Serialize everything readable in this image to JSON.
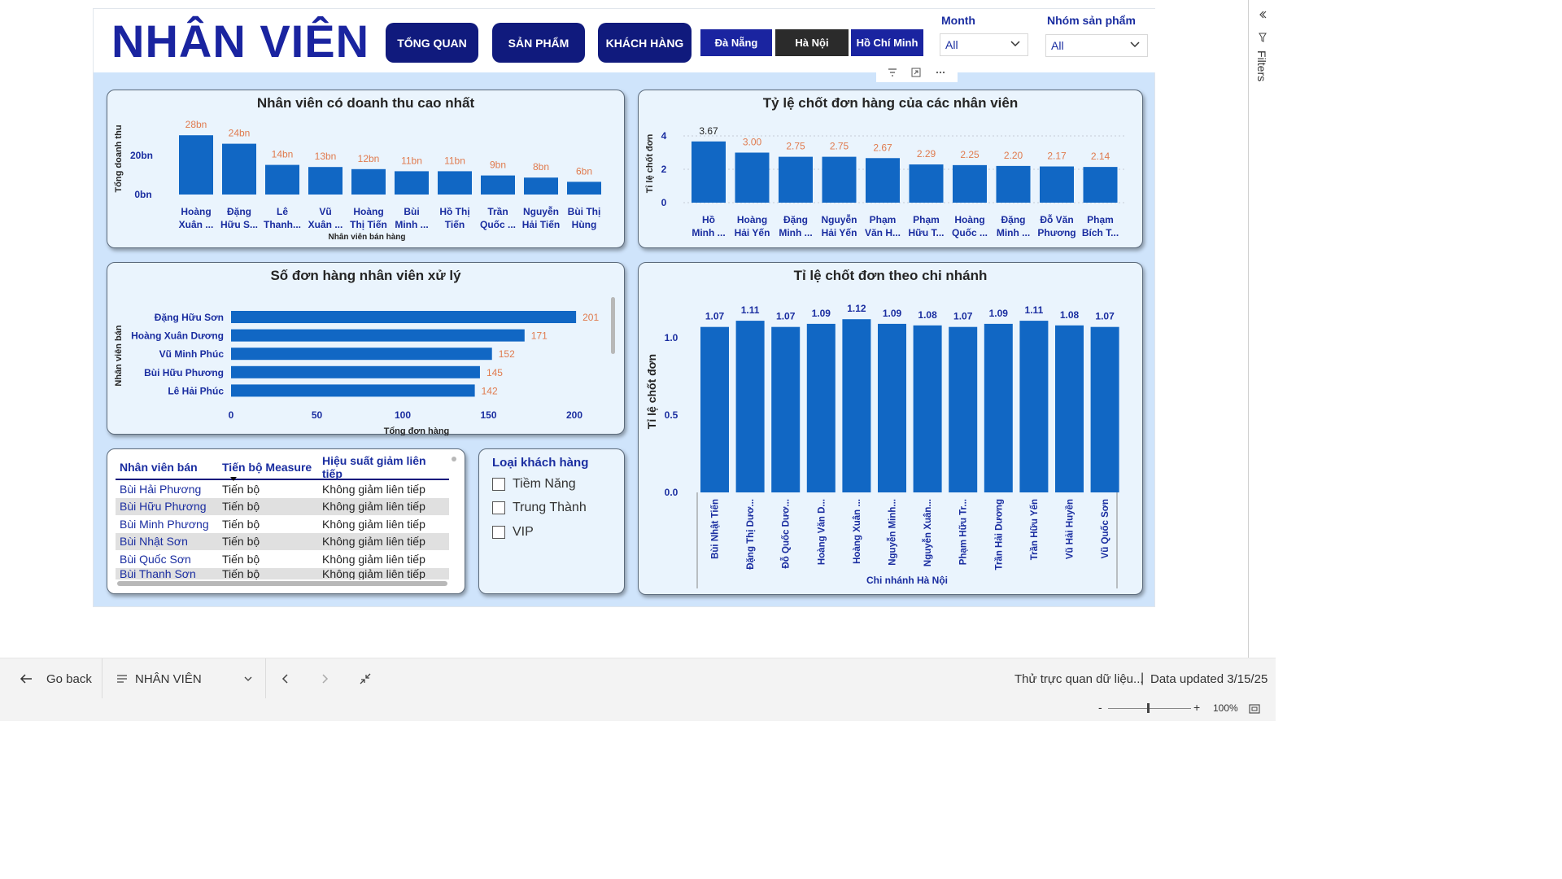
{
  "header": {
    "title": "NHÂN VIÊN",
    "nav_buttons": [
      "TỔNG QUAN",
      "SẢN PHẨM",
      "KHÁCH HÀNG"
    ],
    "city_buttons": [
      {
        "label": "Đà Nẵng",
        "color": "#1a24a0"
      },
      {
        "label": "Hà Nội",
        "color": "#2b2b2b"
      },
      {
        "label": "Hồ Chí Minh",
        "color": "#1a24a0"
      }
    ],
    "month_label": "Month",
    "month_value": "All",
    "group_label": "Nhóm sản phẩm",
    "group_value": "All"
  },
  "colors": {
    "bar": "#1167c4",
    "accent_dark": "#101a7d",
    "data_label": "#e07b4f",
    "panel_bg": "#eaf4fd"
  },
  "chart_data": [
    {
      "type": "bar",
      "title": "Nhân viên có doanh thu cao nhất",
      "xlabel": "Nhân viên bán hàng",
      "ylabel": "Tổng doanh thu",
      "y_ticks": [
        "0bn",
        "20bn"
      ],
      "categories": [
        [
          "Hoàng",
          "Xuân ..."
        ],
        [
          "Đặng",
          "Hữu S..."
        ],
        [
          "Lê",
          "Thanh..."
        ],
        [
          "Vũ",
          "Xuân ..."
        ],
        [
          "Hoàng",
          "Thị Tiến"
        ],
        [
          "Bùi",
          "Minh ..."
        ],
        [
          "Hồ Thị",
          "Tiến"
        ],
        [
          "Trần",
          "Quốc ..."
        ],
        [
          "Nguyễn",
          "Hải Tiến"
        ],
        [
          "Bùi Thị",
          "Hùng"
        ]
      ],
      "values": [
        28,
        24,
        14,
        13,
        12,
        11,
        11,
        9,
        8,
        6
      ],
      "labels": [
        "28bn",
        "24bn",
        "14bn",
        "13bn",
        "12bn",
        "11bn",
        "11bn",
        "9bn",
        "8bn",
        "6bn"
      ],
      "ylim": [
        0,
        30
      ]
    },
    {
      "type": "bar",
      "title": "Tỷ lệ chốt đơn hàng của các nhân viên",
      "ylabel": "Tỉ lệ chốt đơn",
      "y_ticks": [
        "0",
        "2",
        "4"
      ],
      "categories": [
        [
          "Hồ",
          "Minh ..."
        ],
        [
          "Hoàng",
          "Hải Yến"
        ],
        [
          "Đặng",
          "Minh ..."
        ],
        [
          "Nguyễn",
          "Hải Yến"
        ],
        [
          "Phạm",
          "Văn H..."
        ],
        [
          "Phạm",
          "Hữu T..."
        ],
        [
          "Hoàng",
          "Quốc ..."
        ],
        [
          "Đặng",
          "Minh ..."
        ],
        [
          "Đỗ Văn",
          "Phương"
        ],
        [
          "Phạm",
          "Bích T..."
        ]
      ],
      "values": [
        3.67,
        3.0,
        2.75,
        2.75,
        2.67,
        2.29,
        2.25,
        2.2,
        2.17,
        2.14
      ],
      "labels": [
        "3.67",
        "3.00",
        "2.75",
        "2.75",
        "2.67",
        "2.29",
        "2.25",
        "2.20",
        "2.17",
        "2.14"
      ],
      "ylim": [
        0,
        4
      ]
    },
    {
      "type": "bar",
      "orientation": "horizontal",
      "title": "Số đơn hàng nhân viên xử lý",
      "xlabel": "Tổng đơn hàng",
      "ylabel": "Nhân viên bán",
      "x_ticks": [
        "0",
        "50",
        "100",
        "150",
        "200"
      ],
      "categories": [
        "Đặng Hữu Sơn",
        "Hoàng Xuân Dương",
        "Vũ Minh Phúc",
        "Bùi Hữu Phương",
        "Lê Hải Phúc"
      ],
      "values": [
        201,
        171,
        152,
        145,
        142
      ],
      "labels": [
        "201",
        "171",
        "152",
        "145",
        "142"
      ],
      "xlim": [
        0,
        200
      ]
    },
    {
      "type": "bar",
      "title": "Tỉ lệ chốt đơn theo chi nhánh",
      "xlabel": "Chi nhánh Hà Nội",
      "ylabel": "Tỉ lệ chốt đơn",
      "y_ticks": [
        "0.0",
        "0.5",
        "1.0"
      ],
      "categories": [
        "Bùi Nhật Tiến",
        "Đặng Thị Dươ...",
        "Đỗ Quốc Dươ...",
        "Hoàng Văn D...",
        "Hoàng Xuân ...",
        "Nguyễn Minh...",
        "Nguyễn Xuân...",
        "Phạm Hữu Tr...",
        "Trần Hải Dương",
        "Trần Hữu Yến",
        "Vũ Hải Huyền",
        "Vũ Quốc Sơn"
      ],
      "values": [
        1.07,
        1.11,
        1.07,
        1.09,
        1.12,
        1.09,
        1.08,
        1.07,
        1.09,
        1.11,
        1.08,
        1.07
      ],
      "labels": [
        "1.07",
        "1.11",
        "1.07",
        "1.09",
        "1.12",
        "1.09",
        "1.08",
        "1.07",
        "1.09",
        "1.11",
        "1.08",
        "1.07"
      ],
      "ylim": [
        0,
        1.2
      ]
    }
  ],
  "table": {
    "headers": [
      "Nhân viên bán",
      "Tiến bộ Measure",
      "Hiệu suất giảm liên tiếp"
    ],
    "rows": [
      [
        "Bùi Hải Phương",
        "Tiến bộ",
        "Không giảm liên tiếp"
      ],
      [
        "Bùi Hữu Phương",
        "Tiến bộ",
        "Không giảm liên tiếp"
      ],
      [
        "Bùi Minh Phương",
        "Tiến bộ",
        "Không giảm liên tiếp"
      ],
      [
        "Bùi Nhật Sơn",
        "Tiến bộ",
        "Không giảm liên tiếp"
      ],
      [
        "Bùi Quốc Sơn",
        "Tiến bộ",
        "Không giảm liên tiếp"
      ],
      [
        "Bùi Thanh Sơn",
        "Tiến bộ",
        "Không giảm liên tiếp"
      ]
    ]
  },
  "customer_slicer": {
    "title": "Loại khách hàng",
    "options": [
      "Tiềm Năng",
      "Trung Thành",
      "VIP"
    ]
  },
  "bottom_bar": {
    "go_back": "Go back",
    "page_name": "NHÂN VIÊN",
    "status_text": "Thử trực quan dữ liệu...",
    "data_updated": "Data updated 3/15/25",
    "zoom": "100%"
  },
  "filters_pane": {
    "label": "Filters"
  }
}
